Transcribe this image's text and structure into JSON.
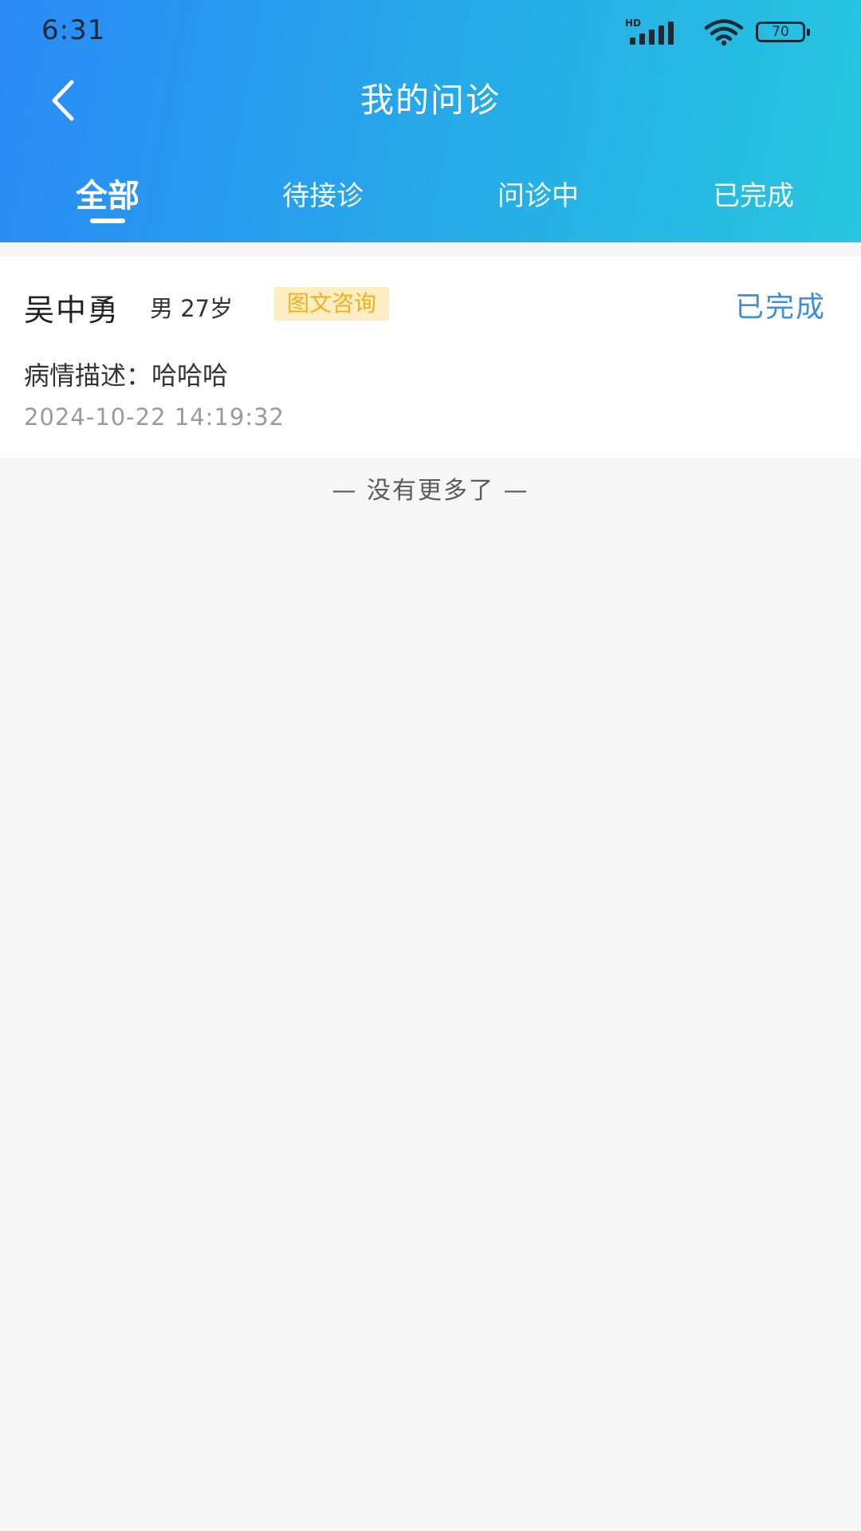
{
  "status_bar": {
    "time": "6:31",
    "network_label": "HD",
    "battery": "70"
  },
  "header": {
    "title": "我的问诊",
    "back_icon": "chevron-left-icon"
  },
  "tabs": [
    {
      "label": "全部",
      "active": true
    },
    {
      "label": "待接诊",
      "active": false
    },
    {
      "label": "问诊中",
      "active": false
    },
    {
      "label": "已完成",
      "active": false
    }
  ],
  "consultations": [
    {
      "name": "吴中勇",
      "meta": "男 27岁",
      "type": "图文咨询",
      "status": "已完成",
      "description": "病情描述：哈哈哈",
      "time": "2024-10-22 14:19:32"
    }
  ],
  "list_end_text": "— 没有更多了 —",
  "colors": {
    "header_gradient_start": "#2a8af7",
    "header_gradient_end": "#28c6e0",
    "status_completed": "#3a8fe0",
    "tag_bg": "#fdedc2",
    "tag_text": "#ebb21a",
    "page_bg": "#f6f6f6"
  }
}
